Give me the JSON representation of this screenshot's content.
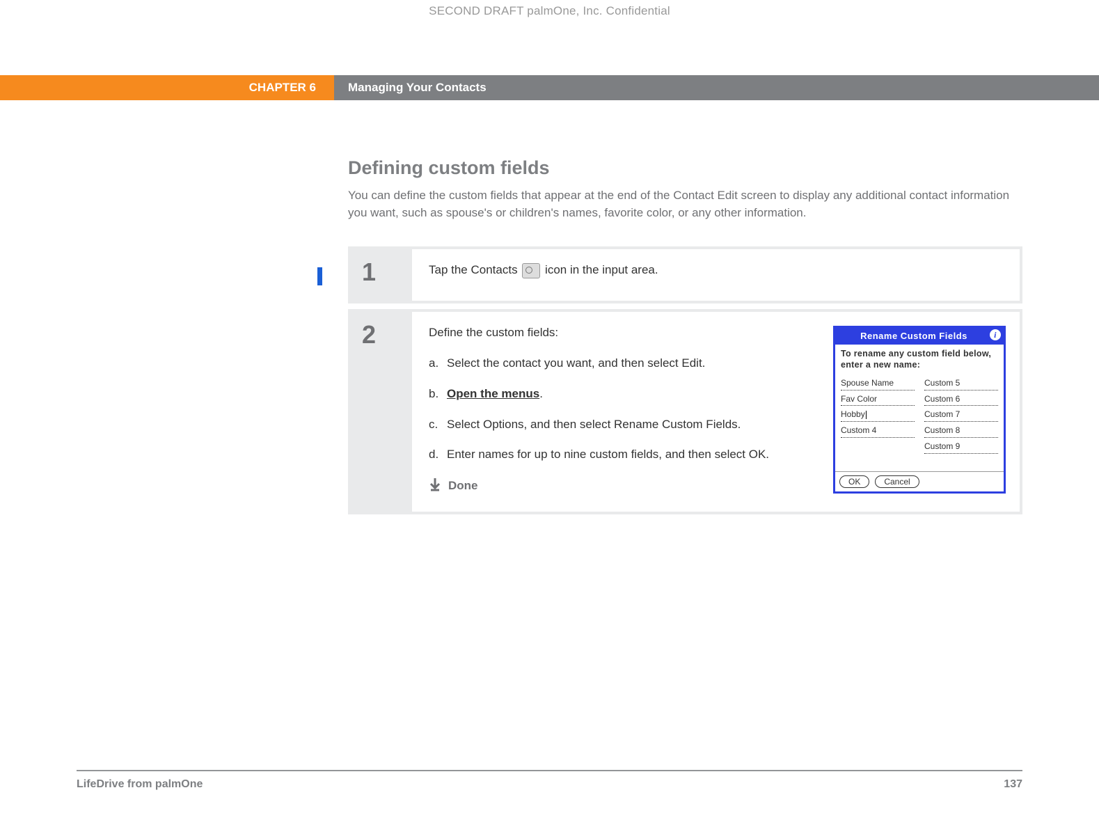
{
  "draft_header": "SECOND DRAFT palmOne, Inc.  Confidential",
  "chapter_label": "CHAPTER 6",
  "chapter_title": "Managing Your Contacts",
  "section_heading": "Defining custom fields",
  "section_intro": "You can define the custom fields that appear at the end of the Contact Edit screen to display any additional contact information you want, such as spouse's or children's names, favorite color, or any other information.",
  "step1": {
    "num": "1",
    "text_before": "Tap the Contacts ",
    "text_after": " icon in the input area."
  },
  "step2": {
    "num": "2",
    "intro": "Define the custom fields:",
    "substeps": {
      "a": {
        "letter": "a.",
        "text": "Select the contact you want, and then select Edit."
      },
      "b": {
        "letter": "b.",
        "link": "Open the menus",
        "after": "."
      },
      "c": {
        "letter": "c.",
        "text": "Select Options, and then select Rename Custom Fields."
      },
      "d": {
        "letter": "d.",
        "text": "Enter names for up to nine custom fields, and then select OK."
      }
    },
    "done": "Done"
  },
  "palm": {
    "title": "Rename Custom Fields",
    "instr": "To rename any custom field below, enter a new name:",
    "left": [
      "Spouse Name",
      "Fav Color",
      "Hobby",
      "Custom 4"
    ],
    "right": [
      "Custom 5",
      "Custom 6",
      "Custom 7",
      "Custom 8",
      "Custom 9"
    ],
    "ok": "OK",
    "cancel": "Cancel"
  },
  "footer": {
    "product": "LifeDrive from palmOne",
    "page": "137"
  }
}
